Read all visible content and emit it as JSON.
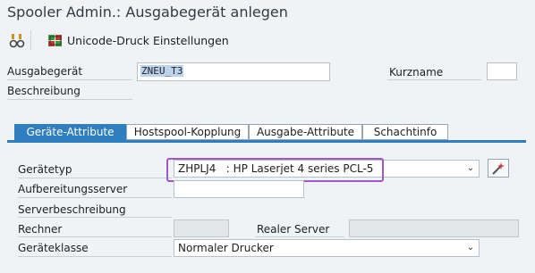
{
  "window": {
    "title": "Spooler Admin.: Ausgabegerät anlegen"
  },
  "toolbar": {
    "glasses_icon": "glasses-icon",
    "unicode_icon": "unicode-settings-icon",
    "unicode_label": "Unicode-Druck Einstellungen"
  },
  "header": {
    "device_label": "Ausgabegerät",
    "device_value": "ZNEU_T3",
    "shortname_label": "Kurzname",
    "shortname_value": "",
    "description_label": "Beschreibung"
  },
  "tabs": [
    {
      "label": "Geräte-Attribute",
      "active": true
    },
    {
      "label": "Hostspool-Kopplung",
      "active": false
    },
    {
      "label": "Ausgabe-Attribute",
      "active": false
    },
    {
      "label": "Schachtinfo",
      "active": false
    }
  ],
  "form": {
    "device_type_label": "Gerätetyp",
    "device_type_value": "ZHPLJ4   : HP Laserjet 4 series PCL-5",
    "formatting_server_label": "Aufbereitungsserver",
    "formatting_server_value": "",
    "server_desc_label": "Serverbeschreibung",
    "host_label": "Rechner",
    "host_value": "",
    "real_server_label": "Realer Server",
    "real_server_value": "",
    "device_class_label": "Geräteklasse",
    "device_class_value": "Normaler Drucker"
  },
  "colors": {
    "active_tab": "#2f7fc0",
    "highlight": "#9b59c9",
    "background": "#f0f3f6"
  }
}
